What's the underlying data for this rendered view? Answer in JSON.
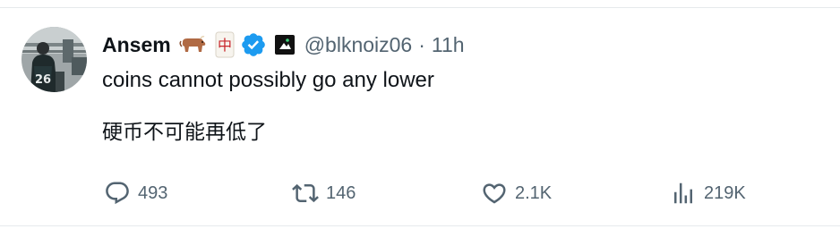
{
  "tweet": {
    "author": {
      "display_name": "Ansem",
      "handle": "@blknoiz06",
      "emoji": "ox-emoji",
      "badge_char": "中",
      "verified_icon": "verified-badge-icon",
      "affiliate_icon": "affiliate-badge-icon",
      "avatar_jersey_number": "26"
    },
    "separator": "·",
    "timestamp": "11h",
    "text_lines": [
      "coins cannot possibly go any lower",
      "硬币不可能再低了"
    ],
    "actions": {
      "reply": {
        "icon": "reply-icon",
        "count": "493"
      },
      "retweet": {
        "icon": "retweet-icon",
        "count": "146"
      },
      "like": {
        "icon": "heart-icon",
        "count": "2.1K"
      },
      "views": {
        "icon": "views-icon",
        "count": "219K"
      }
    },
    "colors": {
      "text_primary": "#0f1419",
      "text_secondary": "#536471",
      "verified_blue": "#1d9bf0",
      "divider": "#e6e9ec"
    }
  }
}
